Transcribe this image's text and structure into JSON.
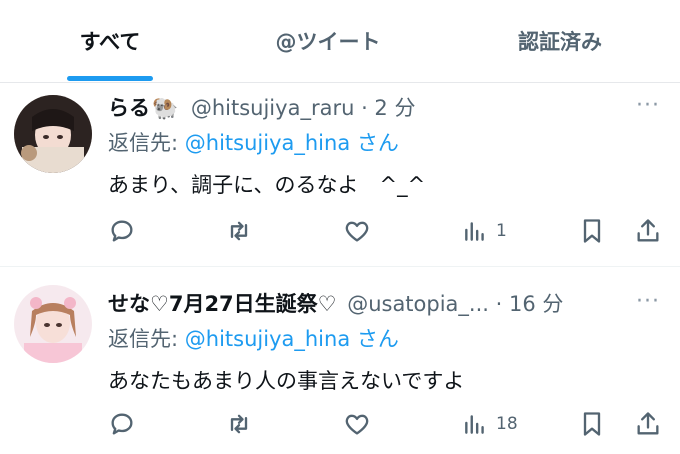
{
  "tabs": [
    {
      "label": "すべて",
      "active": true
    },
    {
      "label": "@ツイート",
      "active": false
    },
    {
      "label": "認証済み",
      "active": false
    }
  ],
  "accent_color": "#1d9bf0",
  "tweets": [
    {
      "name": "らる",
      "name_emoji": "🐏",
      "handle": "@hitsujiya_raru",
      "time": "· 2 分",
      "reply_prefix": "返信先: ",
      "reply_to": "@hitsujiya_hina",
      "reply_suffix": " さん",
      "text": "あまり、調子に、のるなよ　^_^",
      "more": "···",
      "actions": {
        "reply": "",
        "retweet": "",
        "like": "",
        "views": "1"
      }
    },
    {
      "name": "せな♡7月27日生誕祭♡",
      "handle": "@usatopia_...",
      "time": "· 16 分",
      "reply_prefix": "返信先: ",
      "reply_to": "@hitsujiya_hina",
      "reply_suffix": " さん",
      "text": "あなたもあまり人の事言えないですよ",
      "more": "···",
      "actions": {
        "reply": "",
        "retweet": "",
        "like": "",
        "views": "18"
      }
    }
  ]
}
